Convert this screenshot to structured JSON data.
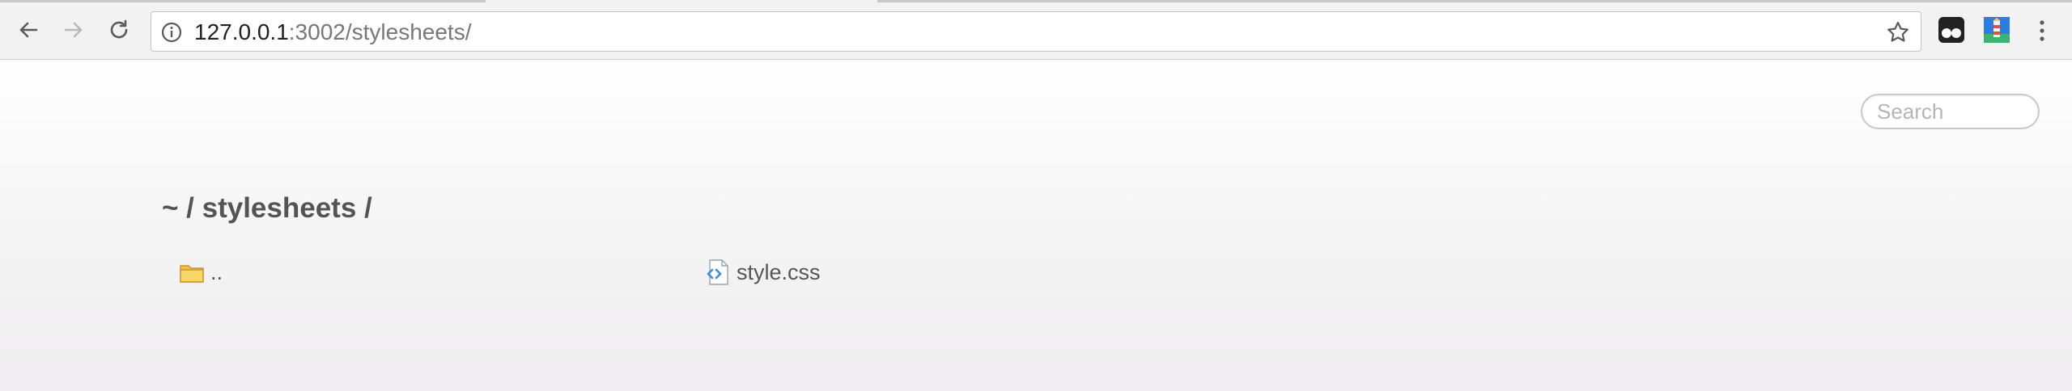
{
  "browser": {
    "url_host": "127.0.0.1",
    "url_path": ":3002/stylesheets/",
    "icons": {
      "back": "back-arrow-icon",
      "forward": "forward-arrow-icon",
      "reload": "reload-icon",
      "info": "info-icon",
      "bookmark": "star-icon",
      "extension_1": "tampermonkey-extension-icon",
      "extension_2": "lighthouse-extension-icon",
      "menu": "kebab-menu-icon"
    }
  },
  "page": {
    "search_placeholder": "Search",
    "breadcrumb": "~ / stylesheets /",
    "files": [
      {
        "name": "..",
        "icon": "folder-icon"
      },
      {
        "name": "style.css",
        "icon": "css-file-icon"
      }
    ]
  },
  "colors": {
    "toolbar_bg": "#f2f2f2",
    "text": "#545454",
    "url_path": "#777777",
    "folder": "#f0c04a",
    "css_icon": "#3a8fd8"
  }
}
